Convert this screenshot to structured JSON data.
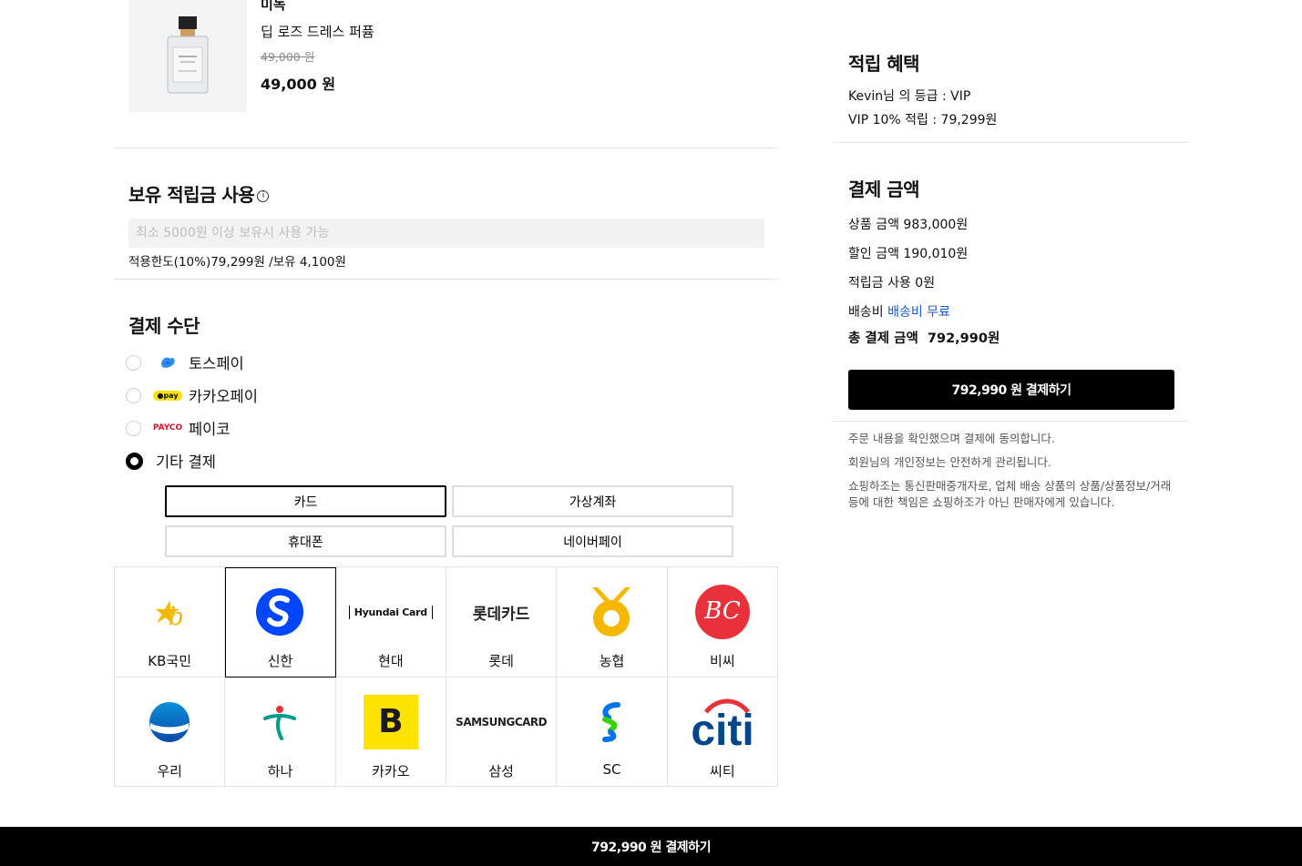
{
  "product": {
    "brand": "미녹",
    "name": "딥 로즈 드레스 퍼퓸",
    "original_price": "49,000 원",
    "sale_price": "49,000 원"
  },
  "points": {
    "title": "보유 적립금 사용",
    "placeholder": "최소 5000원 이상 보유시 사용 가능",
    "limit_text": "적용한도(10%)79,299원 /보유 4,100원"
  },
  "payment_method": {
    "title": "결제 수단",
    "options": [
      {
        "label": "토스페이",
        "icon": "toss-icon",
        "checked": false
      },
      {
        "label": "카카오페이",
        "icon": "kakaopay-icon",
        "checked": false
      },
      {
        "label": "페이코",
        "icon": "payco-icon",
        "checked": false
      },
      {
        "label": "기타 결제",
        "icon": "",
        "checked": true
      }
    ],
    "methods": [
      "카드",
      "가상계좌",
      "휴대폰",
      "네이버페이"
    ],
    "selected_method": "카드",
    "payco_logo_text": "PAYCO",
    "kakaopay_logo_text": "●pay"
  },
  "cards": [
    {
      "name": "KB국민",
      "icon": "kb-card-icon"
    },
    {
      "name": "신한",
      "icon": "shinhan-card-icon",
      "selected": true
    },
    {
      "name": "현대",
      "icon": "hyundai-card-icon",
      "logo_text": "Hyundai Card"
    },
    {
      "name": "롯데",
      "icon": "lotte-card-icon",
      "logo_text": "롯데카드"
    },
    {
      "name": "농협",
      "icon": "nh-card-icon"
    },
    {
      "name": "비씨",
      "icon": "bc-card-icon",
      "logo_text": "BC"
    },
    {
      "name": "우리",
      "icon": "woori-card-icon"
    },
    {
      "name": "하나",
      "icon": "hana-card-icon"
    },
    {
      "name": "카카오",
      "icon": "kakao-card-icon",
      "logo_text": "B"
    },
    {
      "name": "삼성",
      "icon": "samsung-card-icon",
      "logo_text": "SAMSUNGCARD"
    },
    {
      "name": "SC",
      "icon": "sc-card-icon"
    },
    {
      "name": "씨티",
      "icon": "citi-card-icon",
      "logo_text": "citi"
    }
  ],
  "rewards": {
    "title": "적립 혜택",
    "grade_line": "Kevin님 의 등급 : VIP",
    "rate_line": "VIP 10% 적립 : 79,299원"
  },
  "summary": {
    "title": "결제 금액",
    "product_amount": "상품 금액 983,000원",
    "discount_amount": "할인 금액 190,010원",
    "points_used": "적립금 사용 0원",
    "shipping_label": "배송비",
    "shipping_value": "배송비 무료",
    "total_label": "총 결제 금액",
    "total_value": "792,990원"
  },
  "pay_button_label": "792,990 원 결제하기",
  "notices": [
    "주문 내용을 확인했으며 결제에 동의합니다.",
    "회원님의 개인정보는 안전하게 관리됩니다.",
    "쇼핑하조는 통신판매중개자로, 업체 배송 상품의 상품/상품정보/거래 등에 대한 책임은 쇼핑하조가 아닌 판매자에게 있습니다."
  ],
  "bottom_bar_label": "792,990 원 결제하기",
  "colors": {
    "accent": "#000000",
    "link": "#1a55d6"
  }
}
